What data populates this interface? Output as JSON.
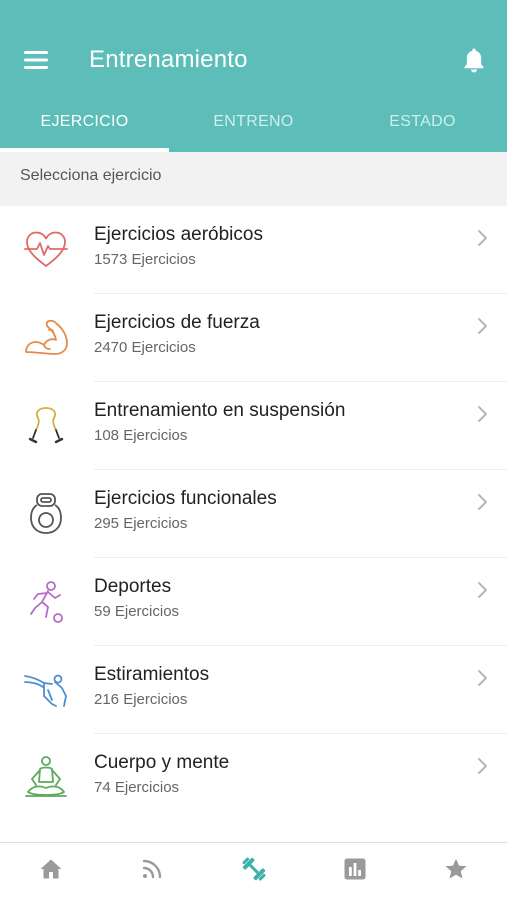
{
  "app_bar": {
    "title": "Entrenamiento",
    "menu_icon": "hamburger-menu-icon",
    "notification_icon": "bell-icon",
    "background_color": "#5cbdb9"
  },
  "tabs": [
    {
      "label": "EJERCICIO",
      "active": true
    },
    {
      "label": "ENTRENO",
      "active": false
    },
    {
      "label": "ESTADO",
      "active": false
    }
  ],
  "section_header": "Selecciona ejercicio",
  "categories": [
    {
      "label": "Ejercicios aeróbicos",
      "count": "1573 Ejercicios",
      "icon": "heart-pulse-icon",
      "color": "#e06a6a"
    },
    {
      "label": "Ejercicios de fuerza",
      "count": "2470 Ejercicios",
      "icon": "flexed-arm-icon",
      "color": "#e58a4a"
    },
    {
      "label": "Entrenamiento en suspensión",
      "count": "108 Ejercicios",
      "icon": "suspension-straps-icon",
      "color": "#d2b13a"
    },
    {
      "label": "Ejercicios funcionales",
      "count": "295 Ejercicios",
      "icon": "kettlebell-icon",
      "color": "#555555"
    },
    {
      "label": "Deportes",
      "count": "59 Ejercicios",
      "icon": "soccer-player-icon",
      "color": "#b56cc6"
    },
    {
      "label": "Estiramientos",
      "count": "216 Ejercicios",
      "icon": "stretching-person-icon",
      "color": "#4a8fd0"
    },
    {
      "label": "Cuerpo y mente",
      "count": "74 Ejercicios",
      "icon": "meditation-person-icon",
      "color": "#5daa5d"
    }
  ],
  "bottom_nav": [
    {
      "icon": "home-icon",
      "active": false
    },
    {
      "icon": "feed-icon",
      "active": false
    },
    {
      "icon": "dumbbell-icon",
      "active": true
    },
    {
      "icon": "bar-chart-icon",
      "active": false
    },
    {
      "icon": "star-icon",
      "active": false
    }
  ],
  "colors": {
    "accent": "#5cbdb9",
    "nav_inactive": "#9a9a9a",
    "nav_active": "#3fb0a9"
  }
}
